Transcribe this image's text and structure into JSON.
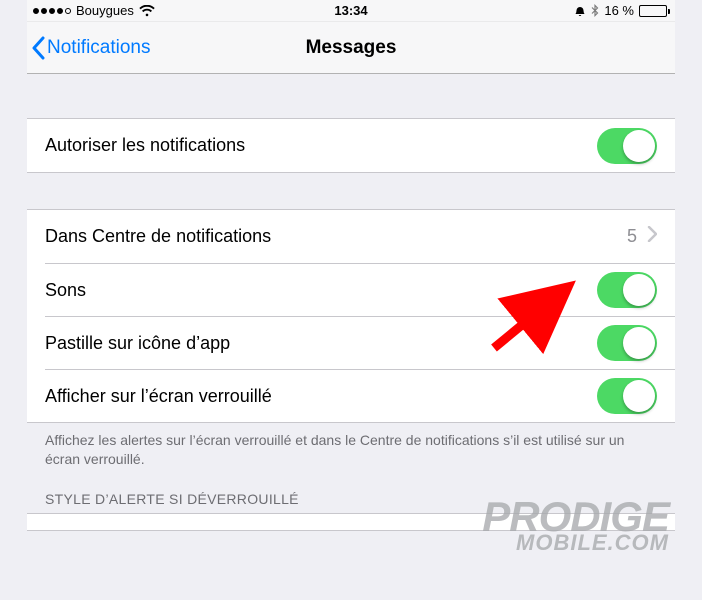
{
  "status": {
    "carrier": "Bouygues",
    "time": "13:34",
    "battery_text": "16 %",
    "battery_level_pct": 16
  },
  "nav": {
    "back_label": "Notifications",
    "title": "Messages"
  },
  "rows": {
    "allow": {
      "label": "Autoriser les notifications",
      "on": true
    },
    "in_nc": {
      "label": "Dans Centre de notifications",
      "value": "5"
    },
    "sounds": {
      "label": "Sons",
      "on": true
    },
    "badge": {
      "label": "Pastille sur icône d’app",
      "on": true
    },
    "lock": {
      "label": "Afficher sur l’écran verrouillé",
      "on": true
    }
  },
  "footer": "Affichez les alertes sur l’écran verrouillé et dans le Centre de notifications s’il est utilisé sur un écran verrouillé.",
  "section_header": "STYLE D’ALERTE SI DÉVERROUILLÉ",
  "watermark": {
    "line1": "PRODIGE",
    "line2": "MOBILE.COM"
  }
}
